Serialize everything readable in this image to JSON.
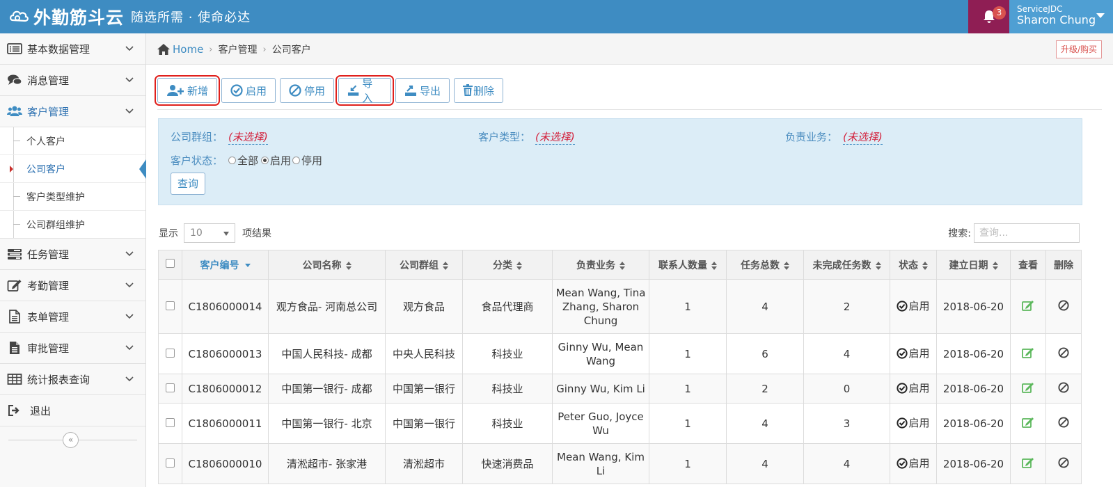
{
  "app": {
    "logo_text": "外勤筋斗云",
    "slogan": "随选所需 · 使命必达",
    "notification_count": "3",
    "user_company": "ServiceJDC",
    "user_name": "Sharon Chung"
  },
  "sidebar": {
    "menus": [
      {
        "label": "基本数据管理",
        "icon": "list-icon"
      },
      {
        "label": "消息管理",
        "icon": "chat-icon"
      },
      {
        "label": "客户管理",
        "icon": "users-icon"
      },
      {
        "label": "任务管理",
        "icon": "tasks-icon"
      },
      {
        "label": "考勤管理",
        "icon": "edit-icon"
      },
      {
        "label": "表单管理",
        "icon": "form-icon"
      },
      {
        "label": "审批管理",
        "icon": "approval-icon"
      },
      {
        "label": "统计报表查询",
        "icon": "table-icon"
      },
      {
        "label": "退出",
        "icon": "logout-icon"
      }
    ],
    "customer_sub": [
      {
        "label": "个人客户"
      },
      {
        "label": "公司客户"
      },
      {
        "label": "客户类型维护"
      },
      {
        "label": "公司群组维护"
      }
    ],
    "collapse_glyph": "«"
  },
  "breadcrumb": {
    "home": "Home",
    "level1": "客户管理",
    "level2": "公司客户",
    "sep": "›",
    "upgrade": "升级/购买"
  },
  "toolbar": {
    "add": "新增",
    "enable": "启用",
    "disable": "停用",
    "import": "导入",
    "export": "导出",
    "delete": "删除"
  },
  "filter": {
    "group_label": "公司群组：",
    "group_value": "(未选择)",
    "type_label": "客户类型：",
    "type_value": "(未选择)",
    "owner_label": "负责业务：",
    "owner_value": "(未选择)",
    "status_label": "客户状态：",
    "status_all": "全部",
    "status_on": "启用",
    "status_off": "停用",
    "query": "查询"
  },
  "list": {
    "show": "显示",
    "page_size": "10",
    "results": "项结果",
    "search_label": "搜索:",
    "search_placeholder": "查询..."
  },
  "table": {
    "headers": [
      "客户编号",
      "公司名称",
      "公司群组",
      "分类",
      "负责业务",
      "联系人数量",
      "任务总数",
      "未完成任务数",
      "状态",
      "建立日期",
      "查看",
      "删除"
    ],
    "rows": [
      {
        "id": "C1806000014",
        "name": "观方食品- 河南总公司",
        "group": "观方食品",
        "category": "食品代理商",
        "owner": "Mean Wang, Tina Zhang, Sharon Chung",
        "contacts": "1",
        "tasks": "4",
        "open": "2",
        "status": "启用",
        "date": "2018-06-20"
      },
      {
        "id": "C1806000013",
        "name": "中国人民科技- 成都",
        "group": "中央人民科技",
        "category": "科技业",
        "owner": "Ginny Wu, Mean Wang",
        "contacts": "1",
        "tasks": "6",
        "open": "4",
        "status": "启用",
        "date": "2018-06-20"
      },
      {
        "id": "C1806000012",
        "name": "中国第一银行- 成都",
        "group": "中国第一银行",
        "category": "科技业",
        "owner": "Ginny Wu, Kim Li",
        "contacts": "1",
        "tasks": "2",
        "open": "0",
        "status": "启用",
        "date": "2018-06-20"
      },
      {
        "id": "C1806000011",
        "name": "中国第一银行- 北京",
        "group": "中国第一银行",
        "category": "科技业",
        "owner": "Peter Guo, Joyce Wu",
        "contacts": "1",
        "tasks": "4",
        "open": "3",
        "status": "启用",
        "date": "2018-06-20"
      },
      {
        "id": "C1806000010",
        "name": "清淞超市- 张家港",
        "group": "清淞超市",
        "category": "快速消费品",
        "owner": "Mean Wang, Kim Li",
        "contacts": "1",
        "tasks": "4",
        "open": "4",
        "status": "启用",
        "date": "2018-06-20"
      }
    ]
  },
  "colors": {
    "topbar": "#3e8cc2",
    "bell_bg": "#8f1e54",
    "user_bg": "#4f9fd3",
    "accent_red": "#d3213c",
    "highlight_box": "#e0201c",
    "edit_green": "#5cb85c"
  }
}
